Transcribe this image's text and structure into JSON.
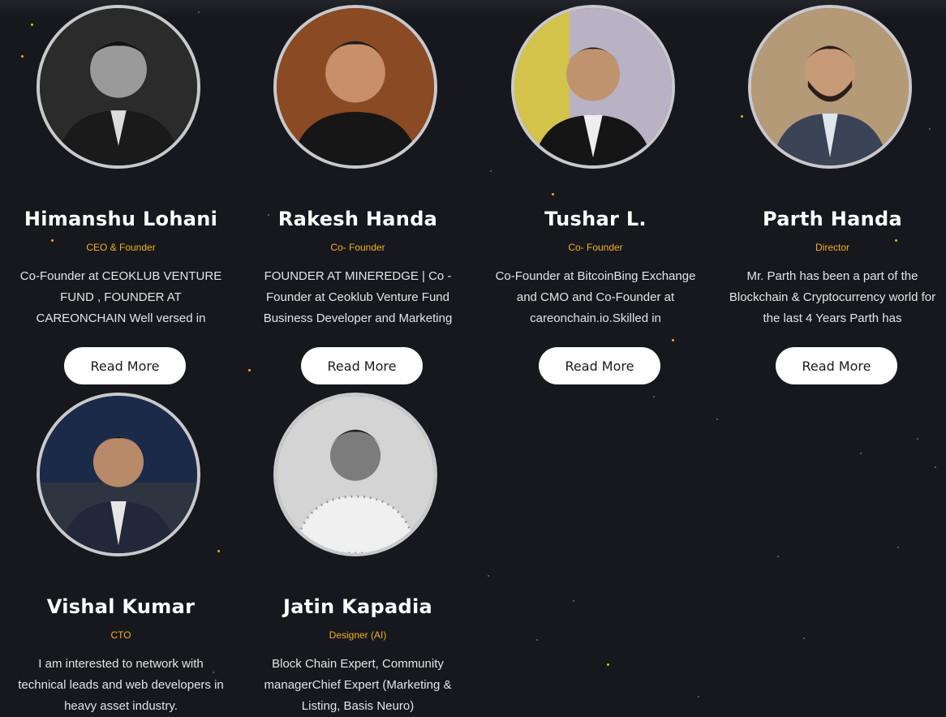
{
  "team": [
    {
      "name": "Himanshu Lohani",
      "role": "CEO & Founder",
      "bio": "Co-Founder at CEOKLUB VENTURE FUND , FOUNDER AT CAREONCHAIN Well versed in",
      "button": "Read More",
      "photo_style": "grayscale",
      "photo_bg": "#2a2a2a"
    },
    {
      "name": "Rakesh Handa",
      "role": "Co- Founder",
      "bio": "FOUNDER AT MINEREDGE | Co -Founder at Ceoklub Venture Fund Business Developer and Marketing",
      "button": "Read More",
      "photo_style": "color",
      "photo_bg": "#8a4a24"
    },
    {
      "name": "Tushar L.",
      "role": "Co- Founder",
      "bio": "Co-Founder at BitcoinBing Exchange and CMO and Co-Founder at careonchain.io.Skilled in",
      "button": "Read More",
      "photo_style": "color",
      "photo_bg": "#c9b24a"
    },
    {
      "name": "Parth Handa",
      "role": "Director",
      "bio": "Mr. Parth has been a part of the Blockchain & Cryptocurrency world for the last 4 Years Parth has",
      "button": "Read More",
      "photo_style": "color",
      "photo_bg": "#b59a78"
    },
    {
      "name": "Vishal Kumar",
      "role": "CTO",
      "bio": "I am interested to network with technical leads and web developers in heavy asset industry.",
      "button": "",
      "photo_style": "color",
      "photo_bg": "#1c2a4a"
    },
    {
      "name": "Jatin Kapadia",
      "role": "Designer (AI)",
      "bio": "Block Chain Expert, Community managerChief Expert (Marketing & Listing, Basis Neuro)",
      "button": "",
      "photo_style": "grayscale",
      "photo_bg": "#cfcfcf"
    }
  ],
  "colors": {
    "background": "#17181d",
    "accent": "#f2b01e",
    "button_bg": "#ffffff"
  }
}
